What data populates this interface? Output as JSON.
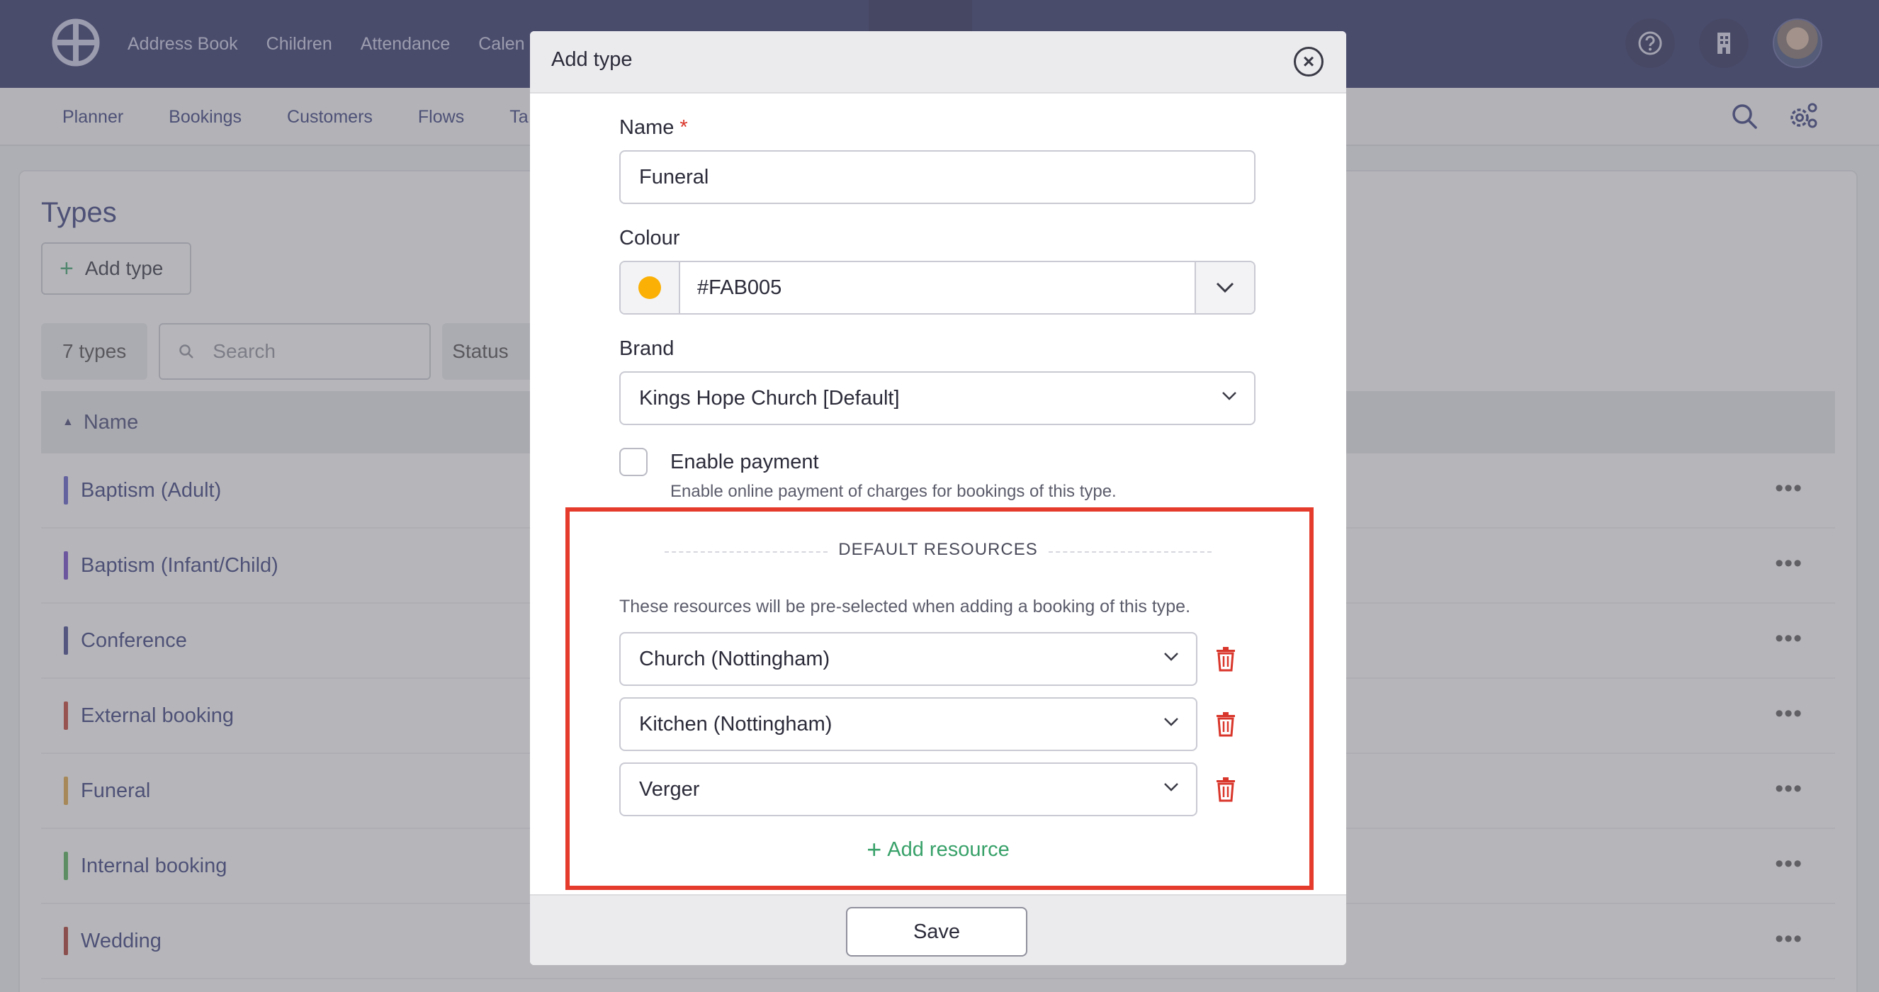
{
  "topnav": {
    "items": [
      "Address Book",
      "Children",
      "Attendance",
      "Calen"
    ]
  },
  "subnav": {
    "items": [
      "Planner",
      "Bookings",
      "Customers",
      "Flows",
      "Ta"
    ]
  },
  "page": {
    "title": "Types",
    "add_button": "Add type",
    "count": "7 types",
    "search_placeholder": "Search",
    "status_label": "Status",
    "column_name": "Name",
    "rows": [
      {
        "name": "Baptism (Adult)",
        "color": "#5a55c8"
      },
      {
        "name": "Baptism (Infant/Child)",
        "color": "#6a3fc6"
      },
      {
        "name": "Conference",
        "color": "#3b3f8a"
      },
      {
        "name": "External booking",
        "color": "#c0392b"
      },
      {
        "name": "Funeral",
        "color": "#e0a23a"
      },
      {
        "name": "Internal booking",
        "color": "#4caf50"
      },
      {
        "name": "Wedding",
        "color": "#a93226"
      }
    ]
  },
  "modal": {
    "title": "Add type",
    "name_label": "Name",
    "required_mark": "*",
    "name_value": "Funeral",
    "colour_label": "Colour",
    "colour_value": "#FAB005",
    "brand_label": "Brand",
    "brand_value": "Kings Hope Church [Default]",
    "enable_payment_label": "Enable payment",
    "enable_payment_help": "Enable online payment of charges for bookings of this type.",
    "enable_payment_checked": false,
    "section_title": "DEFAULT RESOURCES",
    "section_help": "These resources will be pre-selected when adding a booking of this type.",
    "resources": [
      "Church (Nottingham)",
      "Kitchen (Nottingham)",
      "Verger"
    ],
    "add_resource": "Add resource",
    "save": "Save"
  },
  "colors": {
    "topbar": "#272a62",
    "accent_green": "#38a169",
    "danger": "#d9362b",
    "highlight": "#e43b2c"
  }
}
